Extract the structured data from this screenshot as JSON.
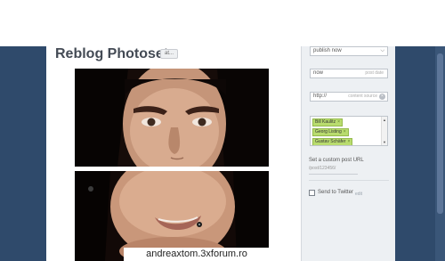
{
  "post": {
    "title": "Reblog Photoset",
    "type_button": "at..."
  },
  "sidebar": {
    "publish_select": "publish now",
    "date_value": "now",
    "date_hint": "post date",
    "source_value": "http://",
    "source_hint": "content source",
    "tags": [
      "Bill Kaulitz",
      "Georg Listing",
      "Gustav Schäfer"
    ],
    "custom_url_label": "Set a custom post URL",
    "custom_url_example": "/post/123456/",
    "twitter_label": "Send to Twitter",
    "twitter_edit": "edit"
  },
  "watermark": "andreaxtom.3xforum.ro"
}
